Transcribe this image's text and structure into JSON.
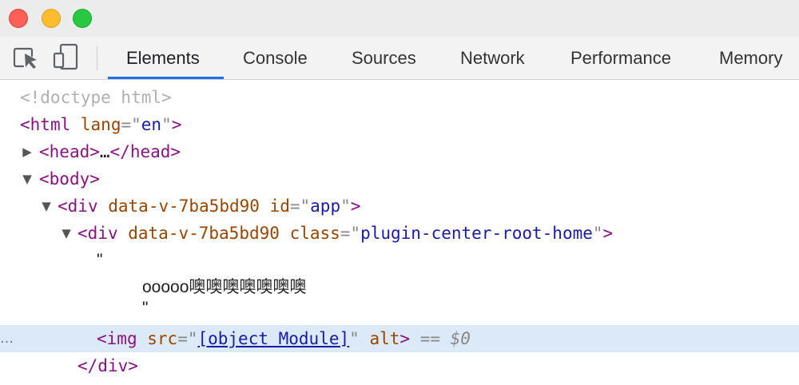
{
  "window": {
    "buttons": [
      "close",
      "minimize",
      "maximize"
    ]
  },
  "toolbar": {
    "icons": [
      "inspect-element-icon",
      "device-toolbar-icon"
    ],
    "tabs": [
      {
        "label": "Elements",
        "active": true
      },
      {
        "label": "Console",
        "active": false
      },
      {
        "label": "Sources",
        "active": false
      },
      {
        "label": "Network",
        "active": false
      },
      {
        "label": "Performance",
        "active": false
      },
      {
        "label": "Memory",
        "active": false
      }
    ],
    "accent_color": "#1a73e8"
  },
  "tree": {
    "doctype": "<!doctype html>",
    "html_tag": "html",
    "html_attr": "lang",
    "html_attr_value": "en",
    "head_tag": "head",
    "head_ellipsis": "…",
    "body_tag": "body",
    "app_div": {
      "tag": "div",
      "attr1": "data-v-7ba5bd90",
      "attr2": "id",
      "attr2_value": "app"
    },
    "home_div": {
      "tag": "div",
      "attr1": "data-v-7ba5bd90",
      "attr2": "class",
      "attr2_value": "plugin-center-root-home"
    },
    "text_node": {
      "open_quote": "\"",
      "content": "ooooo噢噢噢噢噢噢噢",
      "close_quote": "\""
    },
    "img": {
      "tag": "img",
      "attr1": "src",
      "attr1_value": "[object Module]",
      "attr2": "alt",
      "selection_marker": "==",
      "selection_var": "$0",
      "row_dots": "…"
    },
    "close_div_tag": "div"
  }
}
